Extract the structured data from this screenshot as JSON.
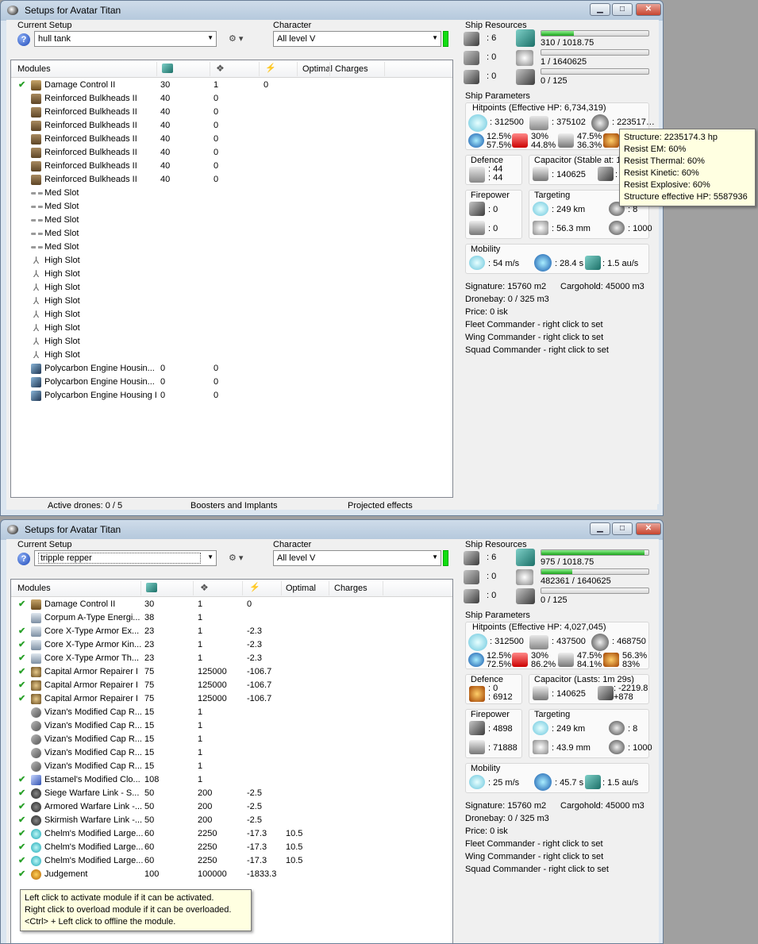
{
  "windows": [
    {
      "title": "Setups for Avatar Titan",
      "current_setup_label": "Current Setup",
      "current_setup_value": "hull tank",
      "character_label": "Character",
      "character_value": "All level V",
      "modules_headers": [
        "Modules",
        "",
        "",
        "",
        "Optimal",
        "Charges"
      ],
      "modules": [
        {
          "checked": true,
          "icon": "dc",
          "name": "Damage Control II",
          "c1": "30",
          "c2": "1",
          "c3": "0",
          "opt": "",
          "chg": ""
        },
        {
          "checked": false,
          "icon": "armor",
          "name": "Reinforced Bulkheads II",
          "c1": "40",
          "c2": "0",
          "c3": "",
          "opt": "",
          "chg": ""
        },
        {
          "checked": false,
          "icon": "armor",
          "name": "Reinforced Bulkheads II",
          "c1": "40",
          "c2": "0",
          "c3": "",
          "opt": "",
          "chg": ""
        },
        {
          "checked": false,
          "icon": "armor",
          "name": "Reinforced Bulkheads II",
          "c1": "40",
          "c2": "0",
          "c3": "",
          "opt": "",
          "chg": ""
        },
        {
          "checked": false,
          "icon": "armor",
          "name": "Reinforced Bulkheads II",
          "c1": "40",
          "c2": "0",
          "c3": "",
          "opt": "",
          "chg": ""
        },
        {
          "checked": false,
          "icon": "armor",
          "name": "Reinforced Bulkheads II",
          "c1": "40",
          "c2": "0",
          "c3": "",
          "opt": "",
          "chg": ""
        },
        {
          "checked": false,
          "icon": "armor",
          "name": "Reinforced Bulkheads II",
          "c1": "40",
          "c2": "0",
          "c3": "",
          "opt": "",
          "chg": ""
        },
        {
          "checked": false,
          "icon": "armor",
          "name": "Reinforced Bulkheads II",
          "c1": "40",
          "c2": "0",
          "c3": "",
          "opt": "",
          "chg": ""
        },
        {
          "checked": false,
          "icon": "med",
          "name": "Med Slot",
          "c1": "",
          "c2": "",
          "c3": "",
          "opt": "",
          "chg": ""
        },
        {
          "checked": false,
          "icon": "med",
          "name": "Med Slot",
          "c1": "",
          "c2": "",
          "c3": "",
          "opt": "",
          "chg": ""
        },
        {
          "checked": false,
          "icon": "med",
          "name": "Med Slot",
          "c1": "",
          "c2": "",
          "c3": "",
          "opt": "",
          "chg": ""
        },
        {
          "checked": false,
          "icon": "med",
          "name": "Med Slot",
          "c1": "",
          "c2": "",
          "c3": "",
          "opt": "",
          "chg": ""
        },
        {
          "checked": false,
          "icon": "med",
          "name": "Med Slot",
          "c1": "",
          "c2": "",
          "c3": "",
          "opt": "",
          "chg": ""
        },
        {
          "checked": false,
          "icon": "high",
          "name": "High Slot",
          "c1": "",
          "c2": "",
          "c3": "",
          "opt": "",
          "chg": ""
        },
        {
          "checked": false,
          "icon": "high",
          "name": "High Slot",
          "c1": "",
          "c2": "",
          "c3": "",
          "opt": "",
          "chg": ""
        },
        {
          "checked": false,
          "icon": "high",
          "name": "High Slot",
          "c1": "",
          "c2": "",
          "c3": "",
          "opt": "",
          "chg": ""
        },
        {
          "checked": false,
          "icon": "high",
          "name": "High Slot",
          "c1": "",
          "c2": "",
          "c3": "",
          "opt": "",
          "chg": ""
        },
        {
          "checked": false,
          "icon": "high",
          "name": "High Slot",
          "c1": "",
          "c2": "",
          "c3": "",
          "opt": "",
          "chg": ""
        },
        {
          "checked": false,
          "icon": "high",
          "name": "High Slot",
          "c1": "",
          "c2": "",
          "c3": "",
          "opt": "",
          "chg": ""
        },
        {
          "checked": false,
          "icon": "high",
          "name": "High Slot",
          "c1": "",
          "c2": "",
          "c3": "",
          "opt": "",
          "chg": ""
        },
        {
          "checked": false,
          "icon": "high",
          "name": "High Slot",
          "c1": "",
          "c2": "",
          "c3": "",
          "opt": "",
          "chg": ""
        },
        {
          "checked": false,
          "icon": "rig",
          "name": "Polycarbon Engine Housin...",
          "c1": "0",
          "c2": "0",
          "c3": "",
          "opt": "",
          "chg": ""
        },
        {
          "checked": false,
          "icon": "rig",
          "name": "Polycarbon Engine Housin...",
          "c1": "0",
          "c2": "0",
          "c3": "",
          "opt": "",
          "chg": ""
        },
        {
          "checked": false,
          "icon": "rig",
          "name": "Polycarbon Engine Housing I",
          "c1": "0",
          "c2": "0",
          "c3": "",
          "opt": "",
          "chg": ""
        }
      ],
      "bottom": {
        "drones": "Active drones: 0 / 5",
        "boosters": "Boosters and Implants",
        "projected": "Projected effects"
      },
      "resources": {
        "title": "Ship Resources",
        "turrets": ": 6",
        "launchers": ": 0",
        "rigs": ": 0",
        "cpu": "310 / 1018.75",
        "cpu_frac": 0.3,
        "pg": "1 / 1640625",
        "pg_frac": 0.0,
        "calibration": "0 / 125",
        "calibration_frac": 0.0
      },
      "params": {
        "title": "Ship Parameters",
        "hitpoints": "Hitpoints (Effective HP: 6,734,319)",
        "shield_hp": ": 312500",
        "armor_hp": ": 375102",
        "struct_hp": ": 223517…",
        "em_a": "12.5%",
        "em_b": "57.5%",
        "th_a": "30%",
        "th_b": "44.8%",
        "ki_a": "47.5%",
        "ki_b": "36.3%",
        "ex_a": "",
        "ex_b": ""
      },
      "defence": {
        "title": "Defence",
        "v1": ": 44",
        "v2": ": 44"
      },
      "capacitor": {
        "title": "Capacitor (Stable at: 10",
        "cap": ": 140625",
        "recharge": ": 1"
      },
      "firepower": {
        "title": "Firepower",
        "v1": ": 0",
        "v2": ": 0"
      },
      "targeting": {
        "title": "Targeting",
        "range": ": 249 km",
        "res": ": 56.3 mm",
        "max_targets": ": 8",
        "sig": ": 1000"
      },
      "mobility": {
        "title": "Mobility",
        "speed": ": 54 m/s",
        "align": ": 28.4 s",
        "warp": ": 1.5 au/s"
      },
      "info": [
        "Signature: 15760 m2",
        "Cargohold: 45000 m3",
        "Dronebay: 0 / 325 m3",
        "Price: 0 isk",
        "Fleet Commander - right click to set",
        "Wing Commander - right click to set",
        "Squad Commander - right click to set"
      ],
      "tooltip": [
        "Structure: 2235174.3 hp",
        "Resist EM: 60%",
        "Resist Thermal: 60%",
        "Resist Kinetic: 60%",
        "Resist Explosive: 60%",
        "Structure effective HP: 5587936"
      ]
    },
    {
      "title": "Setups for Avatar Titan",
      "current_setup_label": "Current Setup",
      "current_setup_value": "tripple repper",
      "character_label": "Character",
      "character_value": "All level V",
      "modules_headers": [
        "Modules",
        "",
        "",
        "",
        "Optimal",
        "Charges"
      ],
      "modules": [
        {
          "checked": true,
          "icon": "dc",
          "name": "Damage Control II",
          "c1": "30",
          "c2": "1",
          "c3": "0",
          "opt": "",
          "chg": ""
        },
        {
          "checked": false,
          "icon": "mod",
          "name": "Corpum A-Type Energi...",
          "c1": "38",
          "c2": "1",
          "c3": "",
          "opt": "",
          "chg": ""
        },
        {
          "checked": true,
          "icon": "mod",
          "name": "Core X-Type Armor Ex...",
          "c1": "23",
          "c2": "1",
          "c3": "-2.3",
          "opt": "",
          "chg": ""
        },
        {
          "checked": true,
          "icon": "mod",
          "name": "Core X-Type Armor Kin...",
          "c1": "23",
          "c2": "1",
          "c3": "-2.3",
          "opt": "",
          "chg": ""
        },
        {
          "checked": true,
          "icon": "mod",
          "name": "Core X-Type Armor Th...",
          "c1": "23",
          "c2": "1",
          "c3": "-2.3",
          "opt": "",
          "chg": ""
        },
        {
          "checked": true,
          "icon": "rep",
          "name": "Capital Armor Repairer I",
          "c1": "75",
          "c2": "125000",
          "c3": "-106.7",
          "opt": "",
          "chg": ""
        },
        {
          "checked": true,
          "icon": "rep",
          "name": "Capital Armor Repairer I",
          "c1": "75",
          "c2": "125000",
          "c3": "-106.7",
          "opt": "",
          "chg": ""
        },
        {
          "checked": true,
          "icon": "rep",
          "name": "Capital Armor Repairer I",
          "c1": "75",
          "c2": "125000",
          "c3": "-106.7",
          "opt": "",
          "chg": ""
        },
        {
          "checked": false,
          "icon": "cap",
          "name": "Vizan's Modified Cap R...",
          "c1": "15",
          "c2": "1",
          "c3": "",
          "opt": "",
          "chg": ""
        },
        {
          "checked": false,
          "icon": "cap",
          "name": "Vizan's Modified Cap R...",
          "c1": "15",
          "c2": "1",
          "c3": "",
          "opt": "",
          "chg": ""
        },
        {
          "checked": false,
          "icon": "cap",
          "name": "Vizan's Modified Cap R...",
          "c1": "15",
          "c2": "1",
          "c3": "",
          "opt": "",
          "chg": ""
        },
        {
          "checked": false,
          "icon": "cap",
          "name": "Vizan's Modified Cap R...",
          "c1": "15",
          "c2": "1",
          "c3": "",
          "opt": "",
          "chg": ""
        },
        {
          "checked": false,
          "icon": "cap",
          "name": "Vizan's Modified Cap R...",
          "c1": "15",
          "c2": "1",
          "c3": "",
          "opt": "",
          "chg": ""
        },
        {
          "checked": true,
          "icon": "clo",
          "name": "Estamel's Modified Clo...",
          "c1": "108",
          "c2": "1",
          "c3": "",
          "opt": "",
          "chg": ""
        },
        {
          "checked": true,
          "icon": "link",
          "name": "Siege Warfare Link - S...",
          "c1": "50",
          "c2": "200",
          "c3": "-2.5",
          "opt": "",
          "chg": ""
        },
        {
          "checked": true,
          "icon": "link",
          "name": "Armored Warfare Link -...",
          "c1": "50",
          "c2": "200",
          "c3": "-2.5",
          "opt": "",
          "chg": ""
        },
        {
          "checked": true,
          "icon": "link",
          "name": "Skirmish Warfare Link -...",
          "c1": "50",
          "c2": "200",
          "c3": "-2.5",
          "opt": "",
          "chg": ""
        },
        {
          "checked": true,
          "icon": "shield",
          "name": "Chelm's Modified Large...",
          "c1": "60",
          "c2": "2250",
          "c3": "-17.3",
          "opt": "10.5",
          "chg": ""
        },
        {
          "checked": true,
          "icon": "shield",
          "name": "Chelm's Modified Large...",
          "c1": "60",
          "c2": "2250",
          "c3": "-17.3",
          "opt": "10.5",
          "chg": ""
        },
        {
          "checked": true,
          "icon": "shield",
          "name": "Chelm's Modified Large...",
          "c1": "60",
          "c2": "2250",
          "c3": "-17.3",
          "opt": "10.5",
          "chg": ""
        },
        {
          "checked": true,
          "icon": "doom",
          "name": "Judgement",
          "c1": "100",
          "c2": "100000",
          "c3": "-1833.3",
          "opt": "",
          "chg": ""
        }
      ],
      "resources": {
        "title": "Ship Resources",
        "turrets": ": 6",
        "launchers": ": 0",
        "rigs": ": 0",
        "cpu": "975 / 1018.75",
        "cpu_frac": 0.96,
        "pg": "482361 / 1640625",
        "pg_frac": 0.29,
        "calibration": "0 / 125",
        "calibration_frac": 0.0
      },
      "params": {
        "title": "Ship Parameters",
        "hitpoints": "Hitpoints (Effective HP: 4,027,045)",
        "shield_hp": ": 312500",
        "armor_hp": ": 437500",
        "struct_hp": ": 468750",
        "em_a": "12.5%",
        "em_b": "72.5%",
        "th_a": "30%",
        "th_b": "86.2%",
        "ki_a": "47.5%",
        "ki_b": "84.1%",
        "ex_a": "56.3%",
        "ex_b": "83%"
      },
      "defence": {
        "title": "Defence",
        "v1": ": 0",
        "v2": ": 6912"
      },
      "capacitor": {
        "title": "Capacitor (Lasts: 1m 29s)",
        "cap": ": 140625",
        "recharge": ": -2219.8",
        "recharge2": "+878"
      },
      "firepower": {
        "title": "Firepower",
        "v1": ": 4898",
        "v2": ": 71888"
      },
      "targeting": {
        "title": "Targeting",
        "range": ": 249 km",
        "res": ": 43.9 mm",
        "max_targets": ": 8",
        "sig": ": 1000"
      },
      "mobility": {
        "title": "Mobility",
        "speed": ": 25 m/s",
        "align": ": 45.7 s",
        "warp": ": 1.5 au/s"
      },
      "info": [
        "Signature: 15760 m2",
        "Cargohold: 45000 m3",
        "Dronebay: 0 / 325 m3",
        "Price: 0 isk",
        "Fleet Commander - right click to set",
        "Wing Commander - right click to set",
        "Squad Commander - right click to set"
      ],
      "tooltip": [
        "Left click to activate module if it can be activated.",
        "Right click to overload module if it can be overloaded.",
        "<Ctrl> + Left click to offline the module."
      ]
    }
  ]
}
